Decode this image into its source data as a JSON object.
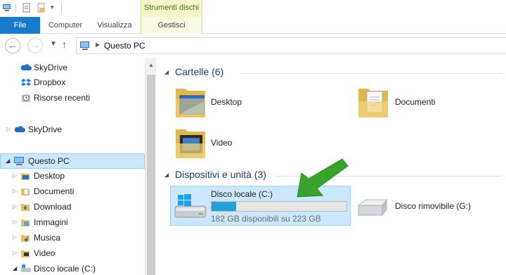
{
  "ribbon": {
    "contextual_group": "Strumenti dischi",
    "tabs": [
      {
        "label": "File",
        "icon": null
      },
      {
        "label": "Computer"
      },
      {
        "label": "Visualizza"
      },
      {
        "label": "Gestisci"
      }
    ]
  },
  "address": {
    "back_icon": "back-arrow-icon",
    "forward_icon": "forward-arrow-icon",
    "recent_icon": "chevron-down-icon",
    "up_icon": "up-arrow-icon",
    "crumb": "Questo PC"
  },
  "nav": {
    "items": [
      {
        "label": "SkyDrive",
        "icon": "cloud-icon"
      },
      {
        "label": "Dropbox",
        "icon": "dropbox-icon"
      },
      {
        "label": "Risorse recenti",
        "icon": "recent-places-icon"
      },
      {
        "label": "SkyDrive",
        "icon": "cloud-icon"
      },
      {
        "label": "Questo PC",
        "icon": "computer-icon"
      },
      {
        "label": "Desktop",
        "icon": "folder-icon"
      },
      {
        "label": "Documenti",
        "icon": "folder-icon"
      },
      {
        "label": "Download",
        "icon": "folder-icon"
      },
      {
        "label": "Immagini",
        "icon": "folder-icon"
      },
      {
        "label": "Musica",
        "icon": "folder-icon"
      },
      {
        "label": "Video",
        "icon": "folder-icon"
      },
      {
        "label": "Disco locale (C:)",
        "icon": "drive-icon"
      }
    ]
  },
  "content": {
    "folders_header": "Cartelle (6)",
    "folders": [
      {
        "label": "Desktop",
        "icon": "desktop-folder-icon"
      },
      {
        "label": "Documenti",
        "icon": "documents-folder-icon"
      },
      {
        "label": "Video",
        "icon": "video-folder-icon"
      }
    ],
    "devices_header": "Dispositivi e unità (3)",
    "drive_c": {
      "name": "Disco locale (C:)",
      "free_text": "182 GB disponibili su 223 GB",
      "used_fraction": 0.18,
      "icon": "windows-drive-icon"
    },
    "removable": {
      "name": "Disco rimovibile (G:)",
      "icon": "removable-drive-icon"
    },
    "annotation_icon": "green-arrow-icon"
  },
  "colors": {
    "file_tab": "#1979ca",
    "selection": "#cce8ff",
    "progress": "#26a0da",
    "contextual": "#f3f7c9",
    "arrow": "#3aa32e"
  }
}
